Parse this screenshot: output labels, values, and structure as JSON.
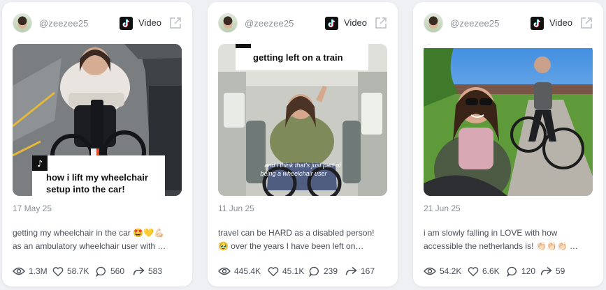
{
  "cards": [
    {
      "handle": "@zeezee25",
      "source_label": "Video",
      "date": "17 May 25",
      "caption_overlay": [
        "how i lift my wheelchair",
        "setup into the car!"
      ],
      "desc_line1": "getting my wheelchair in the car 🤩💛💪🏻",
      "desc_line2": "as an ambulatory wheelchair user with …",
      "views": "1.3M",
      "likes": "58.7K",
      "comments": "560",
      "shares": "583"
    },
    {
      "handle": "@zeezee25",
      "source_label": "Video",
      "date": "11 Jun 25",
      "top_overlay": "getting left on a train",
      "subtitle_overlay": [
        "and i think that's just part of",
        "being a wheelchair user"
      ],
      "desc_line1": "travel can be HARD as a disabled person!",
      "desc_line2": "🥹 over the years I have been left on…",
      "views": "445.4K",
      "likes": "45.1K",
      "comments": "239",
      "shares": "167"
    },
    {
      "handle": "@zeezee25",
      "source_label": "Video",
      "date": "21 Jun 25",
      "desc_line1": "i am slowly falling in LOVE with how",
      "desc_line2": "accessible the netherlands is! 👏🏻👏🏻👏🏻 …",
      "views": "54.2K",
      "likes": "6.6K",
      "comments": "120",
      "shares": "59"
    }
  ],
  "icons": {
    "views": "eye-icon",
    "likes": "heart-icon",
    "comments": "comment-bubble-icon",
    "shares": "share-arrow-icon",
    "platform": "tiktok-icon",
    "open": "external-link-icon"
  }
}
